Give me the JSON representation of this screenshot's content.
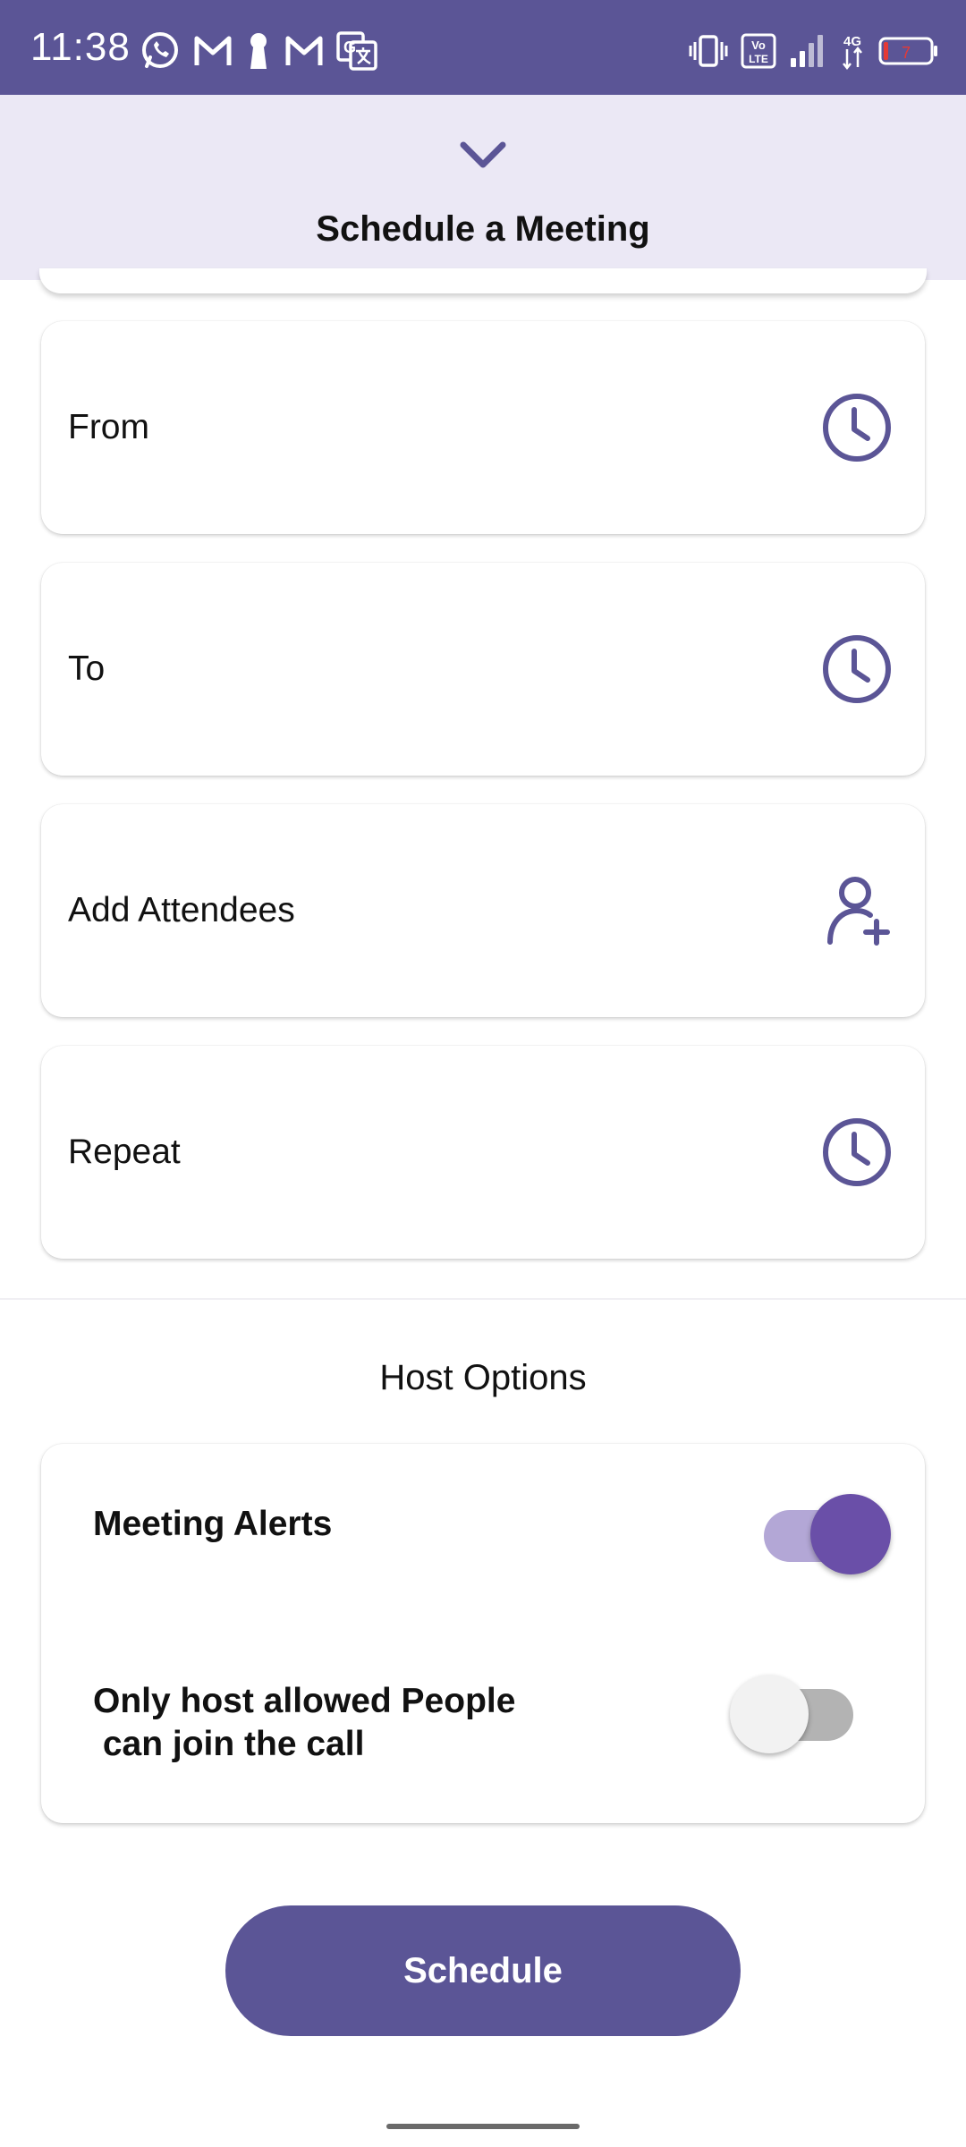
{
  "status_bar": {
    "time": "11:38",
    "left_icons": [
      "whatsapp-icon",
      "gmail-icon",
      "keyhole-icon",
      "gmail-icon",
      "translate-icon"
    ],
    "right_icons": [
      "vibrate-icon",
      "volte-icon",
      "signal-icon",
      "4g-data-icon",
      "battery-icon"
    ],
    "network_label": "4G",
    "volte_label": "Vo LTE",
    "battery_level": "7"
  },
  "header": {
    "title": "Schedule a Meeting",
    "collapse_icon": "chevron-down-icon"
  },
  "fields": {
    "from": {
      "label": "From",
      "icon": "clock-icon"
    },
    "to": {
      "label": "To",
      "icon": "clock-icon"
    },
    "attendees": {
      "label": "Add Attendees",
      "icon": "add-person-icon"
    },
    "repeat": {
      "label": "Repeat",
      "icon": "clock-icon"
    }
  },
  "host_options": {
    "title": "Host Options",
    "meeting_alerts": {
      "label": "Meeting Alerts",
      "enabled": true
    },
    "host_only": {
      "label": "Only host allowed People\n can join the call",
      "enabled": false
    }
  },
  "actions": {
    "schedule_label": "Schedule"
  },
  "colors": {
    "primary": "#5b5596",
    "header_bg": "#ebe8f5",
    "toggle_on_knob": "#6a4fa8",
    "toggle_on_track": "#b3a7d6",
    "toggle_off_knob": "#f2f2f2",
    "toggle_off_track": "#b3b3b3"
  }
}
